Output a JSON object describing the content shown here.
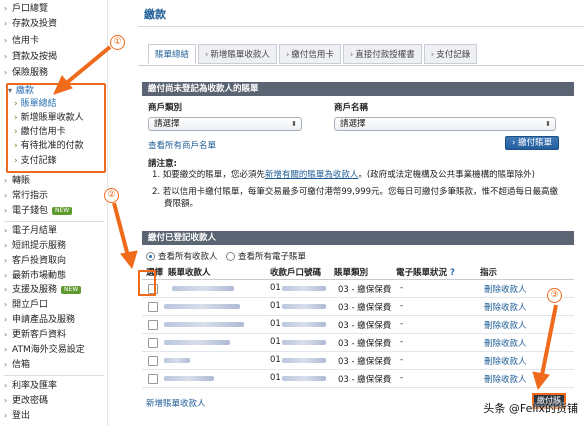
{
  "sidebar": {
    "items_top": [
      "戶口總覽",
      "存款及投資",
      "信用卡",
      "貸款及按揭",
      "保險服務"
    ],
    "active_section": "繳款",
    "active_subitems": [
      "賬單總結",
      "新增賬單收款人",
      "繳付信用卡",
      "有待批准的付款",
      "支付記錄"
    ],
    "items_mid": [
      "轉賬",
      "常行指示",
      "電子錢包"
    ],
    "items_bottom": [
      "電子月結單",
      "短訊提示服務",
      "客戶投資取向",
      "最新市場動態",
      "支援及服務",
      "開立戶口",
      "申請產品及服務",
      "更新客戶資料",
      "ATM海外交易設定",
      "信箱"
    ],
    "items_footer": [
      "利率及匯率",
      "更改密碼",
      "登出"
    ],
    "new_badge": "NEW"
  },
  "main": {
    "title": "繳款",
    "tabs": [
      "賬單總結",
      "新增賬單收款人",
      "繳付信用卡",
      "直接付款授權書",
      "支付記錄"
    ],
    "unregistered": {
      "heading": "繳付尚未登記為收款人的賬單",
      "merchant_type_label": "商戶類別",
      "merchant_name_label": "商戶名稱",
      "select_placeholder": "請選擇",
      "view_all_link": "查看所有商戶名單",
      "pay_button": "繳付賬單"
    },
    "notes": {
      "title": "請注意:",
      "note1_prefix": "1.  如要繳交的賬單，您必須先",
      "note1_link": "新增有關的賬單為收款人",
      "note1_suffix": "。(政府或法定機構及公共事業機構的賬單除外)",
      "note2_line1": "2.  若以信用卡繳付賬單，每筆交易最多可繳付港幣99,999元。您每日可繳付多筆賬款，惟不超過每日最高繳",
      "note2_line2": "費限額。"
    },
    "registered": {
      "heading": "繳付已登記收款人",
      "radio_all_payees": "查看所有收款人",
      "radio_all_ebills": "查看所有電子賬單",
      "columns": [
        "選擇",
        "賬單收款人",
        "收款戶口號碼",
        "賬單類別",
        "電子賬單狀況",
        "指示"
      ],
      "help_icon": "?",
      "rows": [
        {
          "account": "01",
          "category": "03 - 繳保保費",
          "status": "-",
          "action": "刪除收款人"
        },
        {
          "account": "01",
          "category": "03 - 繳保保費",
          "status": "-",
          "action": "刪除收款人"
        },
        {
          "account": "01",
          "category": "03 - 繳保保費",
          "status": "-",
          "action": "刪除收款人"
        },
        {
          "account": "01",
          "category": "03 - 繳保保費",
          "status": "-",
          "action": "刪除收款人"
        },
        {
          "account": "01",
          "category": "03 - 繳保保費",
          "status": "-",
          "action": "刪除收款人"
        },
        {
          "account": "01",
          "category": "03 - 繳保保費",
          "status": "-",
          "action": "刪除收款人"
        }
      ],
      "add_payee_link": "新增賬單收款人",
      "pay_button": "繳付賬單"
    }
  },
  "annotations": {
    "c1": "①",
    "c2": "②",
    "c3": "③",
    "color": "#f06a1b"
  },
  "watermark": "头条 @Felix的货铺"
}
